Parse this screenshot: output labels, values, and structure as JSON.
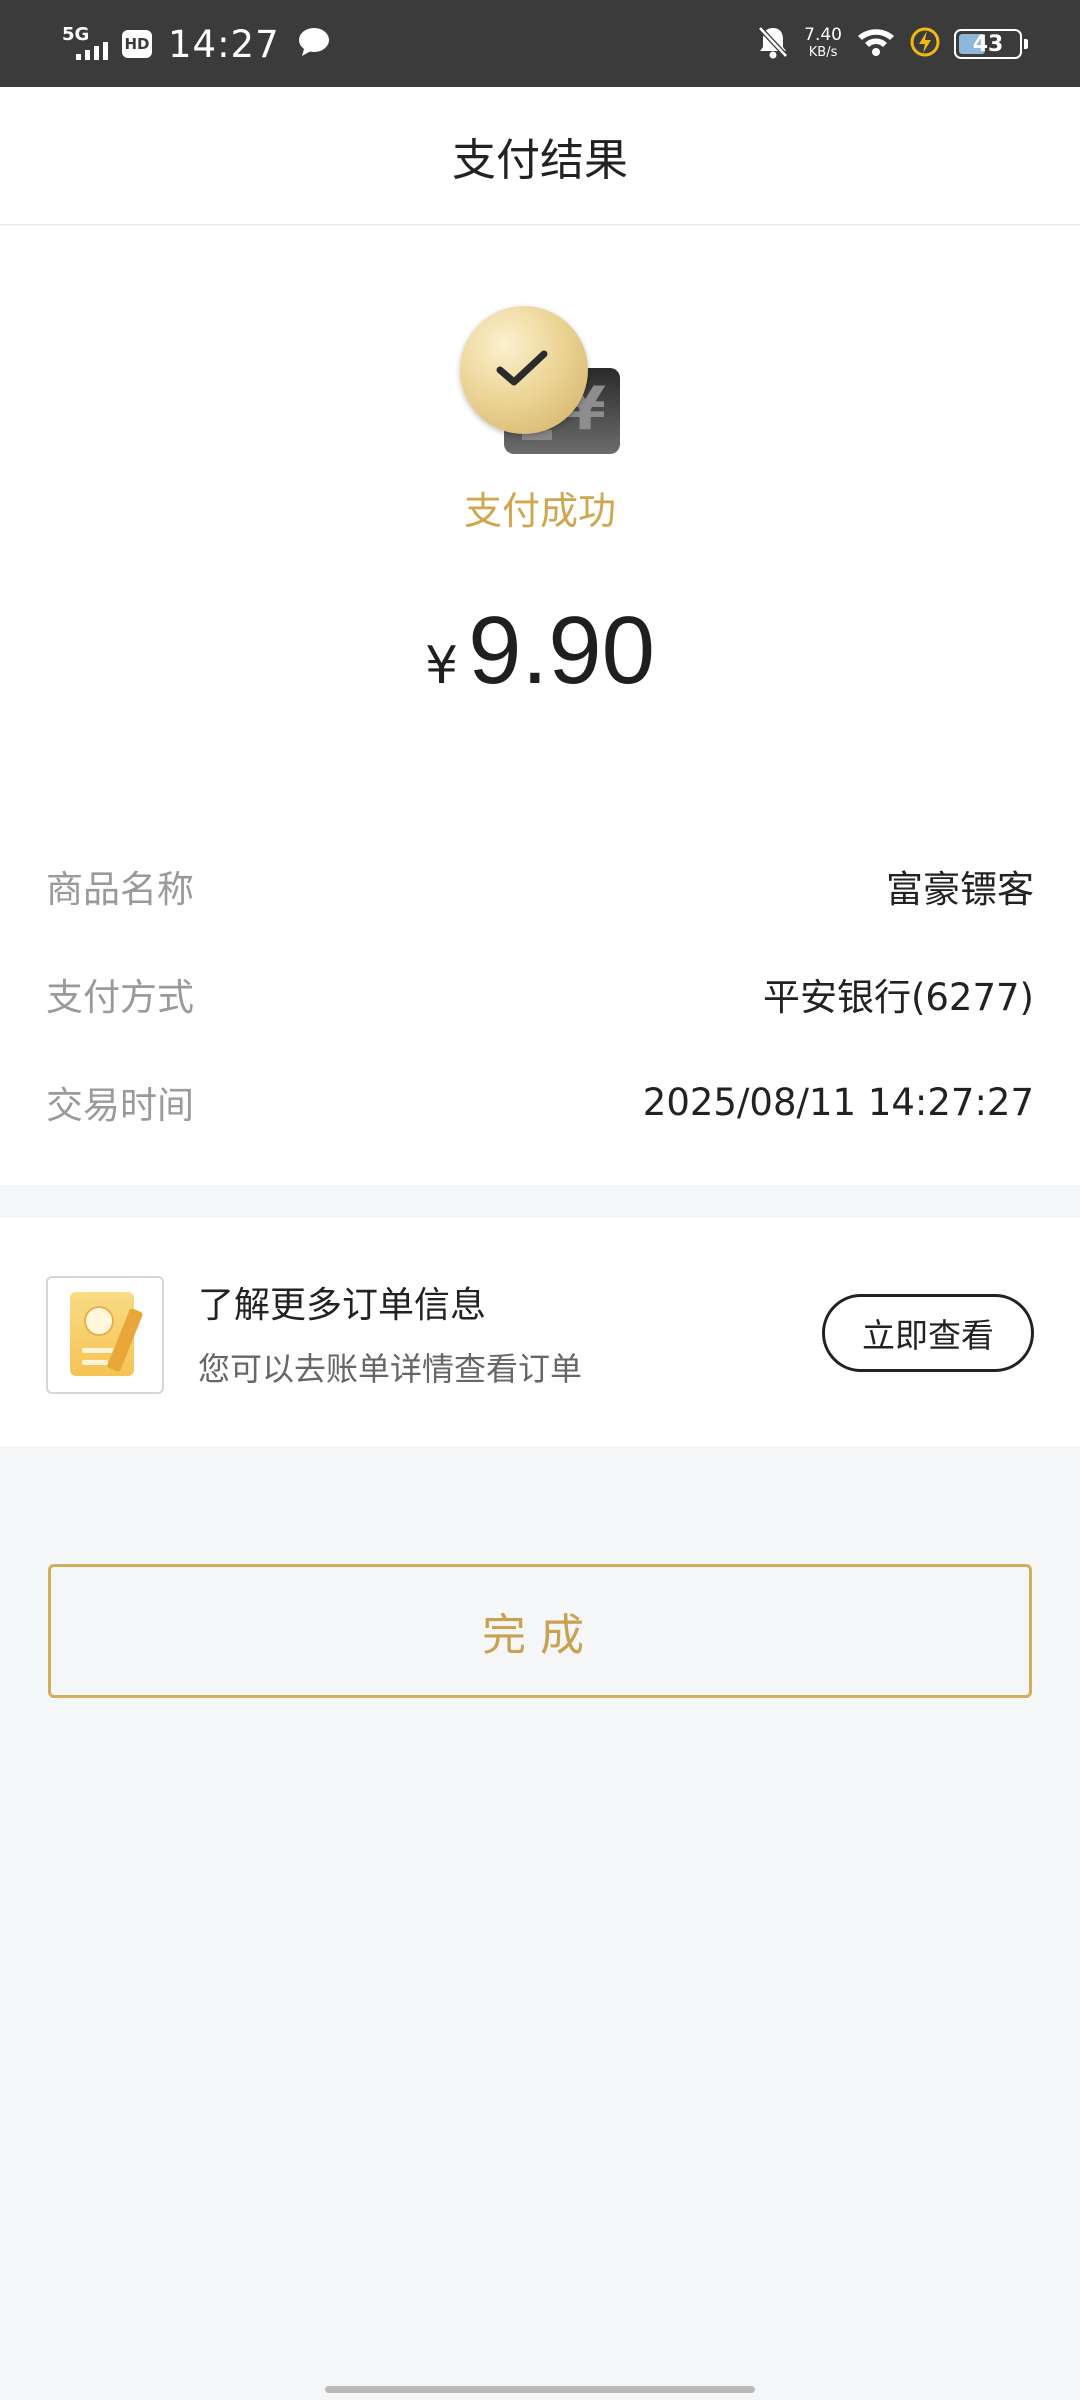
{
  "status_bar": {
    "network": "5G",
    "hd": "HD",
    "time": "14:27",
    "speed_value": "7.40",
    "speed_unit": "KB/s",
    "battery": "43"
  },
  "header": {
    "title": "支付结果"
  },
  "result": {
    "status_text": "支付成功",
    "currency": "¥",
    "amount": "9.90"
  },
  "details": [
    {
      "label": "商品名称",
      "value": "富豪镖客"
    },
    {
      "label": "支付方式",
      "value": "平安银行(6277)"
    },
    {
      "label": "交易时间",
      "value": "2025/08/11 14:27:27"
    }
  ],
  "order_info": {
    "title": "了解更多订单信息",
    "subtitle": "您可以去账单详情查看订单",
    "button": "立即查看"
  },
  "done_button": "完成",
  "colors": {
    "accent_gold": "#d0a64f",
    "status_bar_bg": "#3b3b3b",
    "page_bg": "#f5f6f8"
  }
}
